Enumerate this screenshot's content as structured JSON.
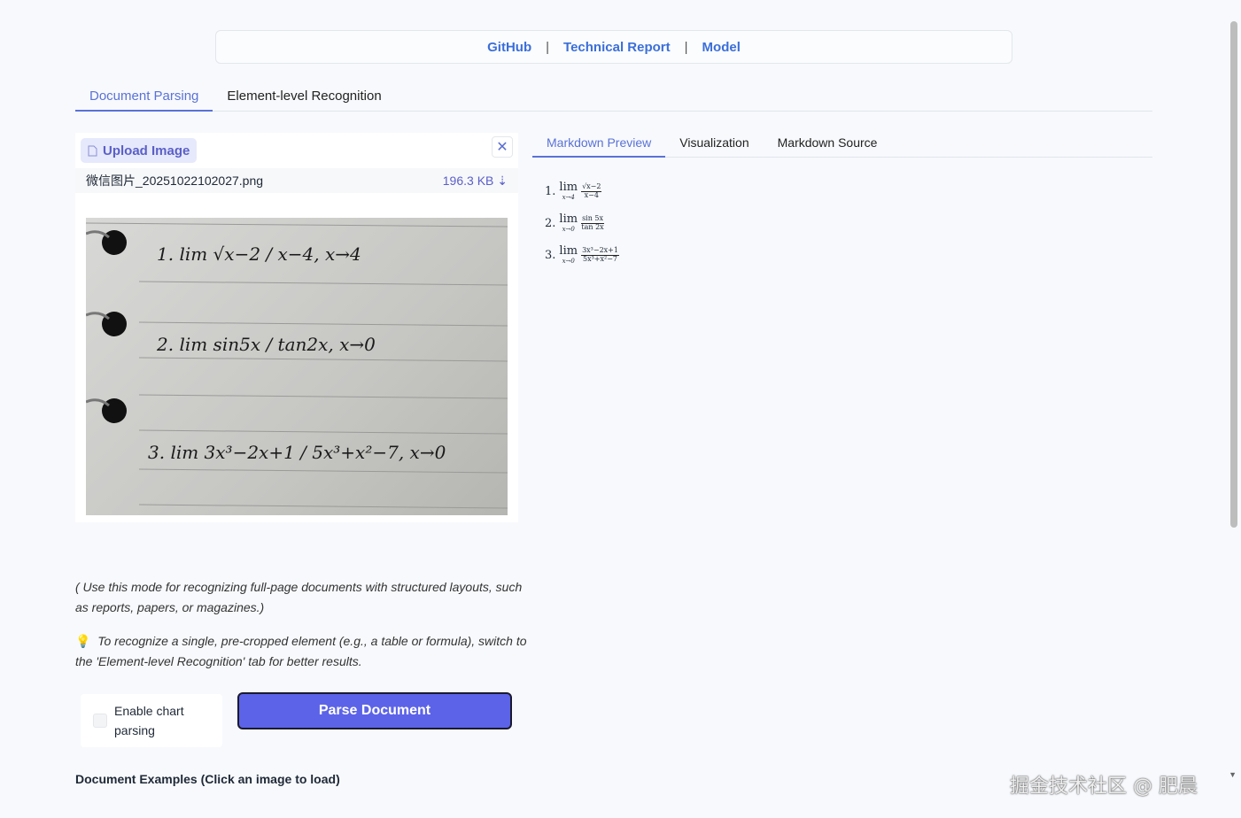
{
  "header": {
    "links": [
      "GitHub",
      "Technical Report",
      "Model"
    ],
    "separator": "|"
  },
  "main_tabs": [
    {
      "label": "Document Parsing",
      "active": true
    },
    {
      "label": "Element-level Recognition",
      "active": false
    }
  ],
  "upload": {
    "button_label": "Upload Image",
    "file_name": "微信图片_20251022102027.png",
    "file_size": "196.3 KB ⇣"
  },
  "handwritten": {
    "l1": "1. lim √x−2 / x−4, x→4",
    "l2": "2. lim sin5x / tan2x, x→0",
    "l3": "3. lim 3x³−2x+1 / 5x³+x²−7, x→0"
  },
  "hints": {
    "mode": "( Use this mode for recognizing full-page documents with structured layouts, such as reports, papers, or magazines.)",
    "tip": "To recognize a single, pre-cropped element (e.g., a table or formula), switch to the 'Element-level Recognition' tab for better results."
  },
  "controls": {
    "chart_parsing_label": "Enable chart parsing",
    "chart_parsing_checked": false,
    "parse_button": "Parse Document"
  },
  "examples_title": "Document Examples (Click an image to load)",
  "right_tabs": [
    {
      "label": "Markdown Preview",
      "active": true
    },
    {
      "label": "Visualization",
      "active": false
    },
    {
      "label": "Markdown Source",
      "active": false
    }
  ],
  "preview": [
    {
      "num": "1.",
      "op": "lim",
      "sub": "x→4",
      "numerator": "√x−2",
      "denominator": "x−4"
    },
    {
      "num": "2.",
      "op": "lim",
      "sub": "x→0",
      "numerator": "sin 5x",
      "denominator": "tan 2x"
    },
    {
      "num": "3.",
      "op": "lim",
      "sub": "x→0",
      "numerator": "3x³−2x+1",
      "denominator": "5x³+x²−7"
    }
  ],
  "watermark": "掘金技术社区 @ 肥晨",
  "colors": {
    "accent": "#5a72d6",
    "button": "#5c63e8",
    "link": "#3b6fd8"
  }
}
